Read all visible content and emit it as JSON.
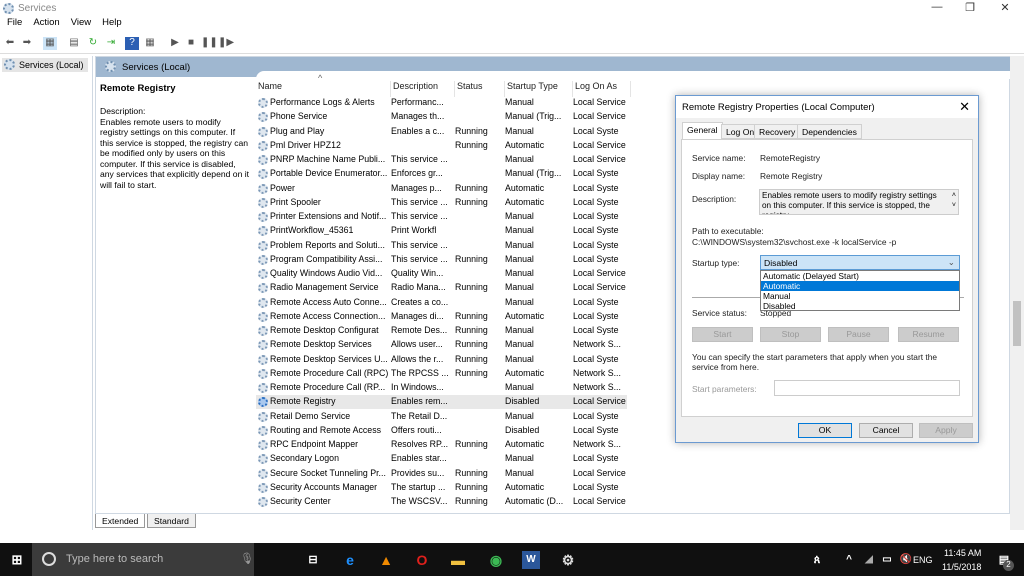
{
  "window": {
    "title": "Services"
  },
  "menu": [
    "File",
    "Action",
    "View",
    "Help"
  ],
  "tree": {
    "root": "Services (Local)"
  },
  "header": {
    "title": "Services (Local)"
  },
  "details": {
    "name": "Remote Registry",
    "desc_label": "Description:",
    "desc": "Enables remote users to modify registry settings on this computer. If this service is stopped, the registry can be modified only by users on this computer. If this service is disabled, any services that explicitly depend on it will fail to start."
  },
  "columns": [
    "Name",
    "Description",
    "Status",
    "Startup Type",
    "Log On As"
  ],
  "rows": [
    [
      "Performance Logs & Alerts",
      "Performanc...",
      "",
      "Manual",
      "Local Service"
    ],
    [
      "Phone Service",
      "Manages th...",
      "",
      "Manual (Trig...",
      "Local Service"
    ],
    [
      "Plug and Play",
      "Enables a c...",
      "Running",
      "Manual",
      "Local Syste"
    ],
    [
      "Pml Driver HPZ12",
      "",
      "Running",
      "Automatic",
      "Local Service"
    ],
    [
      "PNRP Machine Name Publi...",
      "This service ...",
      "",
      "Manual",
      "Local Service"
    ],
    [
      "Portable Device Enumerator...",
      "Enforces gr...",
      "",
      "Manual (Trig...",
      "Local Syste"
    ],
    [
      "Power",
      "Manages p...",
      "Running",
      "Automatic",
      "Local Syste"
    ],
    [
      "Print Spooler",
      "This service ...",
      "Running",
      "Automatic",
      "Local Syste"
    ],
    [
      "Printer Extensions and Notif...",
      "This service ...",
      "",
      "Manual",
      "Local Syste"
    ],
    [
      "PrintWorkflow_45361",
      "Print Workfl",
      "",
      "Manual",
      "Local Syste"
    ],
    [
      "Problem Reports and Soluti...",
      "This service ...",
      "",
      "Manual",
      "Local Syste"
    ],
    [
      "Program Compatibility Assi...",
      "This service ...",
      "Running",
      "Manual",
      "Local Syste"
    ],
    [
      "Quality Windows Audio Vid...",
      "Quality Win...",
      "",
      "Manual",
      "Local Service"
    ],
    [
      "Radio Management Service",
      "Radio Mana...",
      "Running",
      "Manual",
      "Local Service"
    ],
    [
      "Remote Access Auto Conne...",
      "Creates a co...",
      "",
      "Manual",
      "Local Syste"
    ],
    [
      "Remote Access Connection...",
      "Manages di...",
      "Running",
      "Automatic",
      "Local Syste"
    ],
    [
      "Remote Desktop Configurat",
      "Remote Des...",
      "Running",
      "Manual",
      "Local Syste"
    ],
    [
      "Remote Desktop Services",
      "Allows user...",
      "Running",
      "Manual",
      "Network S..."
    ],
    [
      "Remote Desktop Services U...",
      "Allows the r...",
      "Running",
      "Manual",
      "Local Syste"
    ],
    [
      "Remote Procedure Call (RPC)",
      "The RPCSS ...",
      "Running",
      "Automatic",
      "Network S..."
    ],
    [
      "Remote Procedure Call (RP...",
      "In Windows...",
      "",
      "Manual",
      "Network S..."
    ],
    [
      "Remote Registry",
      "Enables rem...",
      "",
      "Disabled",
      "Local Service"
    ],
    [
      "Retail Demo Service",
      "The Retail D...",
      "",
      "Manual",
      "Local Syste"
    ],
    [
      "Routing and Remote Access",
      "Offers routi...",
      "",
      "Disabled",
      "Local Syste"
    ],
    [
      "RPC Endpoint Mapper",
      "Resolves RP...",
      "Running",
      "Automatic",
      "Network S..."
    ],
    [
      "Secondary Logon",
      "Enables star...",
      "",
      "Manual",
      "Local Syste"
    ],
    [
      "Secure Socket Tunneling Pr...",
      "Provides su...",
      "Running",
      "Manual",
      "Local Service"
    ],
    [
      "Security Accounts Manager",
      "The startup ...",
      "Running",
      "Automatic",
      "Local Syste"
    ],
    [
      "Security Center",
      "The WSCSV...",
      "Running",
      "Automatic (D...",
      "Local Service"
    ]
  ],
  "selected_row": 21,
  "view_tabs": [
    "Extended",
    "Standard"
  ],
  "dialog": {
    "title": "Remote Registry Properties (Local Computer)",
    "tabs": [
      "General",
      "Log On",
      "Recovery",
      "Dependencies"
    ],
    "service_name_label": "Service name:",
    "service_name": "RemoteRegistry",
    "display_name_label": "Display name:",
    "display_name": "Remote Registry",
    "description_label": "Description:",
    "description": "Enables remote users to modify registry settings on this computer. If this service is stopped, the registry",
    "path_label": "Path to executable:",
    "path": "C:\\WINDOWS\\system32\\svchost.exe -k localService -p",
    "startup_label": "Startup type:",
    "startup_value": "Disabled",
    "startup_options": [
      "Automatic (Delayed Start)",
      "Automatic",
      "Manual",
      "Disabled"
    ],
    "highlighted_option": 1,
    "status_label": "Service status:",
    "status": "Stopped",
    "buttons": [
      "Start",
      "Stop",
      "Pause",
      "Resume"
    ],
    "hint": "You can specify the start parameters that apply when you start the service from here.",
    "params_label": "Start parameters:",
    "ok": "OK",
    "cancel": "Cancel",
    "apply": "Apply"
  },
  "taskbar": {
    "search_placeholder": "Type here to search",
    "time": "11:45 AM",
    "date": "11/5/2018",
    "lang": "ENG",
    "notifications": "2"
  }
}
